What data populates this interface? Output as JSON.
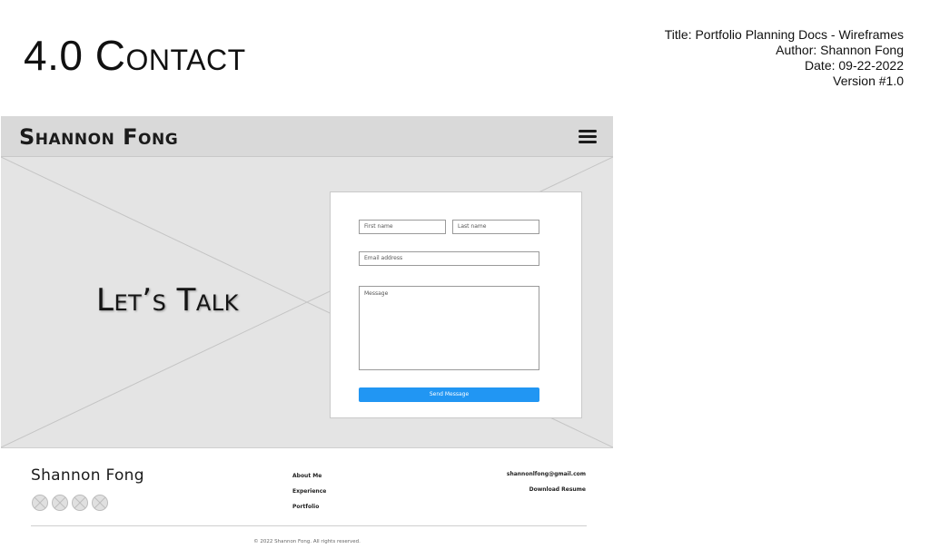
{
  "slide": {
    "title": "4.0 Contact",
    "meta": {
      "title_line": "Title: Portfolio Planning Docs - Wireframes",
      "author_line": "Author: Shannon Fong",
      "date_line": "Date: 09-22-2022",
      "version_line": "Version #1.0"
    }
  },
  "wireframe": {
    "nav": {
      "brand": "Shannon Fong",
      "menu_icon": "hamburger-menu-icon"
    },
    "hero": {
      "heading": "Let’s Talk",
      "background": "image-placeholder"
    },
    "form": {
      "first_name_placeholder": "First name",
      "last_name_placeholder": "Last name",
      "email_placeholder": "Email address",
      "message_placeholder": "Message",
      "send_label": "Send Message",
      "accent_color": "#2196f3"
    },
    "footer": {
      "brand": "Shannon Fong",
      "social_icons": [
        "social-placeholder-icon",
        "social-placeholder-icon",
        "social-placeholder-icon",
        "social-placeholder-icon"
      ],
      "links": [
        "About Me",
        "Experience",
        "Portfolio"
      ],
      "email": "shannonlfong@gmail.com",
      "resume": "Download Resume",
      "copyright": "© 2022 Shannon Fong. All rights reserved."
    }
  }
}
